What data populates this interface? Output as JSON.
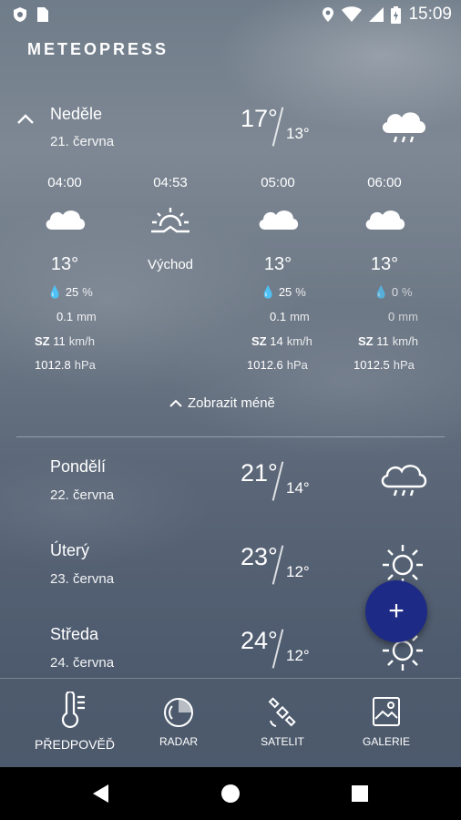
{
  "status": {
    "time": "15:09"
  },
  "app": {
    "title": "METEOPRESS"
  },
  "today": {
    "day": "Neděle",
    "date": "21. června",
    "high": "17°",
    "low": "13°",
    "icon": "cloud-rain-icon",
    "hours": [
      {
        "time": "04:00",
        "icon": "cloud-icon",
        "temp": "13°",
        "precip_prob": "25",
        "precip_unit": "%",
        "precip_amount": "0.1",
        "precip_amount_unit": "mm",
        "wind_dir": "SZ",
        "wind_speed": "11",
        "wind_unit": "km/h",
        "pressure": "1012.8",
        "pressure_unit": "hPa"
      },
      {
        "time": "04:53",
        "icon": "sunrise-icon",
        "label": "Východ"
      },
      {
        "time": "05:00",
        "icon": "cloud-icon",
        "temp": "13°",
        "precip_prob": "25",
        "precip_unit": "%",
        "precip_amount": "0.1",
        "precip_amount_unit": "mm",
        "wind_dir": "SZ",
        "wind_speed": "14",
        "wind_unit": "km/h",
        "pressure": "1012.6",
        "pressure_unit": "hPa"
      },
      {
        "time": "06:00",
        "icon": "cloud-icon",
        "temp": "13°",
        "precip_prob": "0",
        "precip_unit": "%",
        "precip_amount": "0",
        "precip_amount_unit": "mm",
        "wind_dir": "SZ",
        "wind_speed": "11",
        "wind_unit": "km/h",
        "pressure": "1012.5",
        "pressure_unit": "hPa"
      }
    ],
    "show_less": "Zobrazit méně"
  },
  "days": [
    {
      "day": "Pondělí",
      "date": "22. června",
      "high": "21°",
      "low": "14°",
      "icon": "cloud-rain-icon"
    },
    {
      "day": "Úterý",
      "date": "23. června",
      "high": "23°",
      "low": "12°",
      "icon": "sun-icon"
    },
    {
      "day": "Středa",
      "date": "24. června",
      "high": "24°",
      "low": "12°",
      "icon": "sun-icon"
    }
  ],
  "fab": {
    "label": "+"
  },
  "tabs": [
    {
      "label": "PŘEDPOVĚĎ",
      "icon": "thermometer-icon"
    },
    {
      "label": "RADAR",
      "icon": "radar-icon"
    },
    {
      "label": "SATELIT",
      "icon": "satellite-icon"
    },
    {
      "label": "GALERIE",
      "icon": "gallery-icon"
    }
  ]
}
